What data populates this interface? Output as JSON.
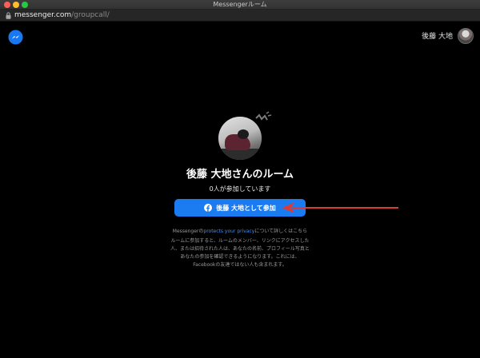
{
  "window": {
    "title": "Messengerルーム"
  },
  "address_bar": {
    "domain": "messenger.com",
    "path": "/groupcall/"
  },
  "header": {
    "user_name": "後藤 大地"
  },
  "room": {
    "title": "後藤 大地さんのルーム",
    "participants": "0人が参加しています",
    "join_button_label": "後藤 大地として参加"
  },
  "privacy": {
    "prefix": "Messengerの",
    "link": "protects your privacy",
    "suffix": "について詳しくはこちら"
  },
  "notice": {
    "text": "ルームに参加すると、ルームのメンバー、リンクにアクセスした人、または招待された人は、あなたの名前、プロフィール写真とあなたの参加を確認できるようになります。これには、Facebookの友達ではない人も含まれます。"
  },
  "colors": {
    "join_button": "#1b7cf2",
    "privacy_link": "#3b8ff5",
    "annotation_arrow": "#d93a3a"
  },
  "icons": {
    "app_logo": "messenger-logo-icon",
    "lock": "lock-icon",
    "join": "facebook-icon",
    "decoration": "sparkle-icon"
  }
}
